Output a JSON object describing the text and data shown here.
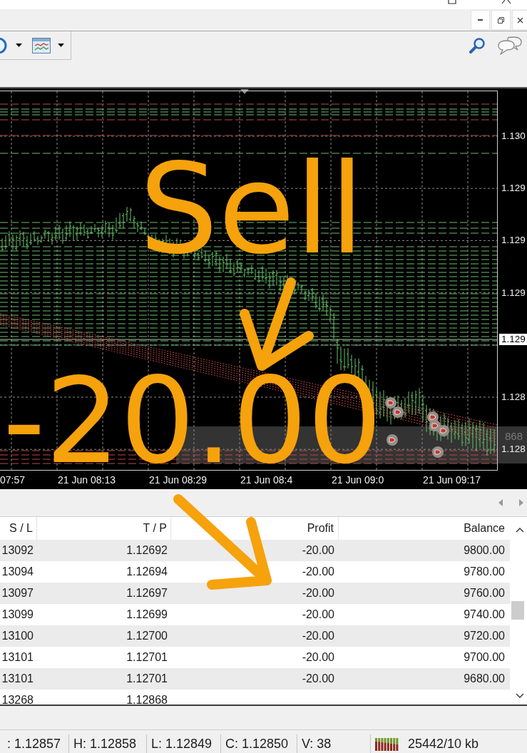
{
  "chart": {
    "price_axis": [
      "1.130",
      "1.129",
      "1.129",
      "1.129",
      "1.128",
      "1.128"
    ],
    "current_price": "1.129",
    "trade_label": "868",
    "time_axis": [
      "07:57",
      "21 Jun 08:13",
      "21 Jun 08:29",
      "21 Jun 08:4",
      "21 Jun 09:0",
      "21 Jun 09:17"
    ]
  },
  "annotations": [
    {
      "text": "Sell"
    },
    {
      "text": "-20.00"
    }
  ],
  "table": {
    "columns": [
      "S / L",
      "T / P",
      "Profit",
      "Balance"
    ],
    "rows": [
      [
        "13092",
        "1.12692",
        "-20.00",
        "9800.00"
      ],
      [
        "13094",
        "1.12694",
        "-20.00",
        "9780.00"
      ],
      [
        "13097",
        "1.12697",
        "-20.00",
        "9760.00"
      ],
      [
        "13099",
        "1.12699",
        "-20.00",
        "9740.00"
      ],
      [
        "13100",
        "1.12700",
        "-20.00",
        "9720.00"
      ],
      [
        "13101",
        "1.12701",
        "-20.00",
        "9700.00"
      ],
      [
        "13101",
        "1.12701",
        "-20.00",
        "9680.00"
      ],
      [
        "13268",
        "1.12868"
      ]
    ]
  },
  "status_bar": {
    "fields": [
      ": 1.12857",
      "H: 1.12858",
      "L: 1.12849",
      "C: 1.12850",
      "V: 38"
    ],
    "traffic": "25442/10 kb"
  }
}
